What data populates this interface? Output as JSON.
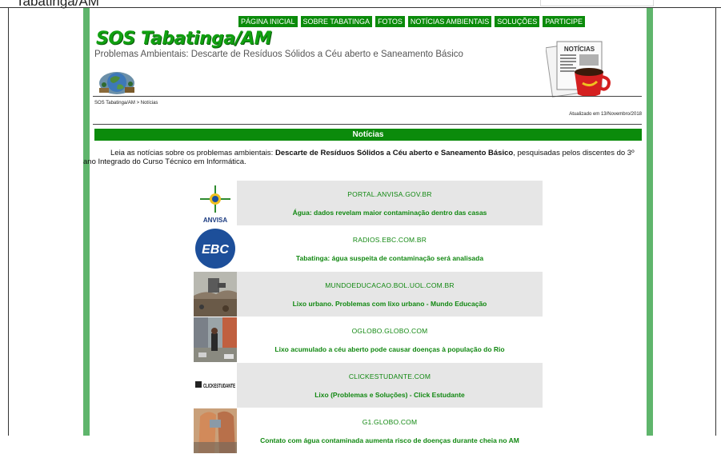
{
  "top": {
    "title": "Tabatinga/AM"
  },
  "nav": [
    "PÁGINA INICIAL",
    "SOBRE TABATINGA",
    "FOTOS",
    "NOTÍCIAS AMBIENTAIS",
    "SOLUÇÕES",
    "PARTICIPE"
  ],
  "header": {
    "site_title": "SOS Tabatinga/AM",
    "subtitle": "Problemas Ambientais: Descarte de Resíduos Sólidos a Céu aberto e Saneamento Básico",
    "news_badge": "NOTÍCIAS"
  },
  "breadcrumb": "SOS Tabatinga/AM > Notícias",
  "updated": "Atualizado em 13/Novembro/2018",
  "section_title": "Notícias",
  "intro": {
    "before": "Leia as notícias sobre os problemas ambientais: ",
    "bold": "Descarte de Resíduos Sólidos a Céu aberto e Saneamento Básico",
    "after": ", pesquisadas pelos discentes do 3º ano Integrado do Curso Técnico em Informática."
  },
  "news": [
    {
      "domain": "PORTAL.ANVISA.GOV.BR",
      "headline": "Água: dados revelam maior contaminação dentro das casas",
      "logo_text": "ANVISA",
      "background": "gray"
    },
    {
      "domain": "RADIOS.EBC.COM.BR",
      "headline": "Tabatinga: água suspeita de contaminação será analisada",
      "logo_text": "EBC",
      "background": "white"
    },
    {
      "domain": "MUNDOEDUCACAO.BOL.UOL.COM.BR",
      "headline": "Lixo urbano. Problemas com lixo urbano - Mundo Educação",
      "logo_text": "",
      "background": "gray"
    },
    {
      "domain": "OGLOBO.GLOBO.COM",
      "headline": "Lixo acumulado a céu aberto pode causar doenças à população do Rio",
      "logo_text": "",
      "background": "white"
    },
    {
      "domain": "CLICKESTUDANTE.COM",
      "headline": "Lixo (Problemas e Soluções) - Click Estudante",
      "logo_text": "CLICKESTUDANTE",
      "background": "gray"
    },
    {
      "domain": "G1.GLOBO.COM",
      "headline": "Contato com água contaminada aumenta risco de doenças durante cheia no AM",
      "logo_text": "",
      "background": "white"
    }
  ],
  "colors": {
    "frame": "#5fb56c",
    "nav_green": "#0b8b0b",
    "link_green": "#118811",
    "card_gray": "#e6e6e6"
  }
}
